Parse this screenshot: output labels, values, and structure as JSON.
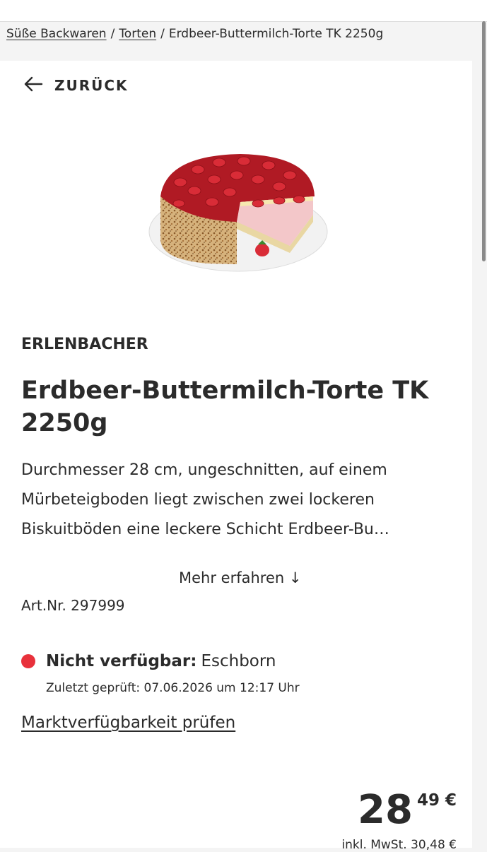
{
  "breadcrumb": {
    "items": [
      {
        "label": "Süße Backwaren"
      },
      {
        "label": "Torten"
      },
      {
        "label": "Erdbeer-Buttermilch-Torte TK 2250g"
      }
    ],
    "separator": "/"
  },
  "back": {
    "label": "ZURÜCK"
  },
  "product": {
    "brand": "ERLENBACHER",
    "title": "Erdbeer-Buttermilch-Torte TK 2250g",
    "description_lines": [
      "Durchmesser 28 cm, ungeschnitten, auf einem",
      "Mürbeteigboden liegt zwischen zwei lockeren",
      "Biskuitböden eine leckere Schicht Erdbeer-Bu…"
    ],
    "more_label": "Mehr erfahren ↓",
    "article_number": "Art.Nr. 297999"
  },
  "availability": {
    "status_label": "Nicht verfügbar:",
    "store": "Eschborn",
    "last_checked": "Zuletzt geprüft: 07.06.2026 um 12:17 Uhr",
    "check_link": "Marktverfügbarkeit prüfen",
    "status_color": "#e8313b"
  },
  "price": {
    "integer": "28",
    "decimal": "49 €",
    "tax_note": "inkl. MwSt. 30,48 €"
  },
  "icons": {
    "back": "arrow-left-icon",
    "status": "red-dot-icon"
  }
}
